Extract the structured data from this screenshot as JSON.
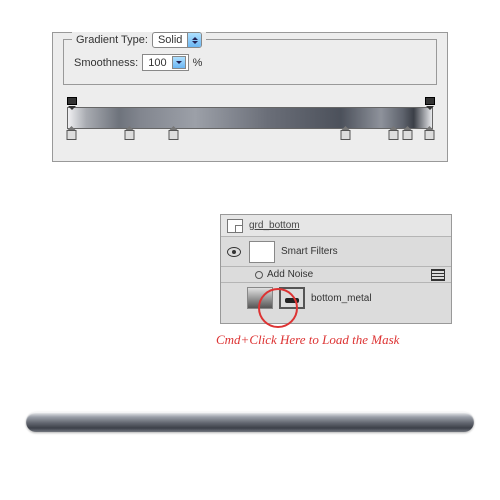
{
  "gradient_editor": {
    "type_label": "Gradient Type:",
    "type_value": "Solid",
    "smoothness_label": "Smoothness:",
    "smoothness_value": "100",
    "smoothness_unit": "%",
    "opacity_stops_pct": [
      1,
      99
    ],
    "color_stops_pct": [
      1,
      17,
      29,
      76,
      89,
      93,
      99
    ]
  },
  "layers": {
    "group_name": "grd_bottom",
    "smart_filters_label": "Smart Filters",
    "filter_name": "Add Noise",
    "layer_name": "bottom_metal"
  },
  "callout": {
    "text": "Cmd+Click Here to Load the Mask"
  }
}
